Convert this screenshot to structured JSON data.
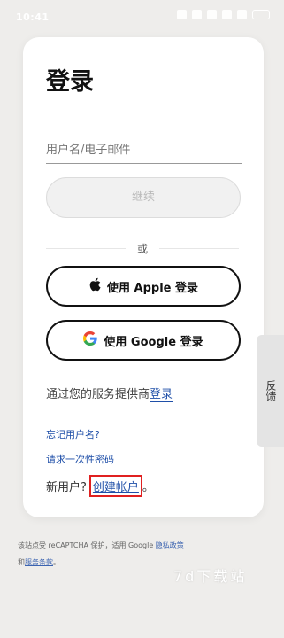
{
  "status_bar": {
    "time": "10:41",
    "icons": [
      "do-not-disturb-icon",
      "bluetooth-icon",
      "vibrate-icon",
      "wifi-icon",
      "signal-icon",
      "battery-icon"
    ]
  },
  "login": {
    "title": "登录",
    "username_placeholder": "用户名/电子邮件",
    "continue_label": "继续",
    "or_label": "或",
    "apple_label": "使用 Apple 登录",
    "google_label": "使用 Google 登录",
    "provider_text": "通过您的服务提供商",
    "provider_link": "登录",
    "forgot_username": "忘记用户名?",
    "request_otp": "请求一次性密码",
    "new_user_text": "新用户?",
    "create_account": "创建帐户",
    "create_suffix": "。"
  },
  "feedback_tab": {
    "label": "反馈"
  },
  "footer": {
    "line1": "该站点受 reCAPTCHA 保护，适用 Google ",
    "privacy_link": "隐私政策",
    "line2_prefix": "和",
    "terms_link": "服务条款",
    "line2_suffix": "。"
  },
  "watermark": "7d下载站",
  "colors": {
    "background": "#eeedeb",
    "link": "#1f4fa8",
    "highlight_box": "#e02020"
  }
}
